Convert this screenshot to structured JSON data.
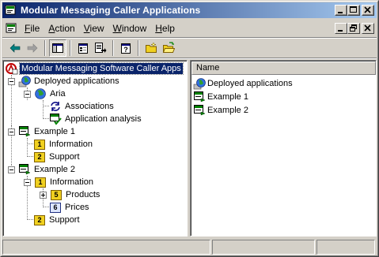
{
  "window": {
    "title": "Modular Messaging Caller Applications",
    "title_icon": "mmca-app-icon",
    "controls": [
      "minimize-icon",
      "maximize-icon",
      "close-icon"
    ]
  },
  "menubar": {
    "items": [
      {
        "label": "File",
        "mnemonic": "F"
      },
      {
        "label": "Action",
        "mnemonic": "A"
      },
      {
        "label": "View",
        "mnemonic": "V"
      },
      {
        "label": "Window",
        "mnemonic": "W"
      },
      {
        "label": "Help",
        "mnemonic": "H"
      }
    ],
    "mdi_controls": [
      "mdi-minimize-icon",
      "mdi-restore-icon",
      "mdi-close-icon"
    ]
  },
  "toolbar": {
    "buttons": [
      "back-arrow-icon",
      "forward-arrow-icon",
      "show-hide-tree-icon",
      "properties-icon",
      "export-list-icon",
      "help-icon",
      "new-application-icon",
      "open-folder-icon"
    ]
  },
  "tree": {
    "root": "Modular Messaging Software Caller Apps",
    "deployed": "Deployed applications",
    "aria": "Aria",
    "associations": "Associations",
    "application_analysis": "Application analysis",
    "example1": "Example 1",
    "ex1_information": "Information",
    "ex1_support": "Support",
    "example2": "Example 2",
    "ex2_information": "Information",
    "ex2_products": "Products",
    "ex2_prices": "Prices",
    "ex2_support": "Support",
    "numbers": {
      "information": "1",
      "support": "2",
      "products": "5",
      "prices": "6"
    }
  },
  "list": {
    "column_name": "Name",
    "items": [
      "Deployed applications",
      "Example 1",
      "Example 2"
    ]
  },
  "statusbar": {
    "cells": [
      "",
      "",
      ""
    ]
  }
}
